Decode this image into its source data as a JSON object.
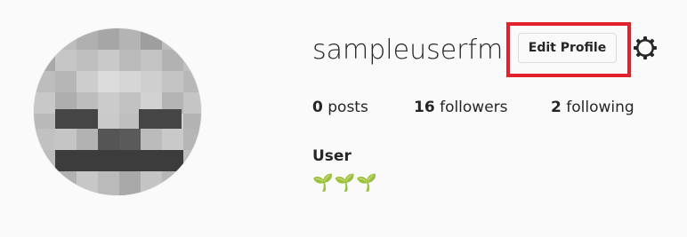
{
  "profile": {
    "username": "sampleuserfm",
    "edit_profile_label": "Edit Profile",
    "full_name": "User",
    "bio": "🌱🌱🌱",
    "stats": {
      "posts_count": "0",
      "posts_label": "posts",
      "followers_count": "16",
      "followers_label": "followers",
      "following_count": "2",
      "following_label": "following"
    }
  },
  "icons": {
    "settings": "gear-icon",
    "avatar": "pixel-skull-avatar"
  },
  "colors": {
    "background": "#fafafa",
    "text": "#262626",
    "button_border": "#dbdbdb",
    "highlight": "#e3212d"
  }
}
